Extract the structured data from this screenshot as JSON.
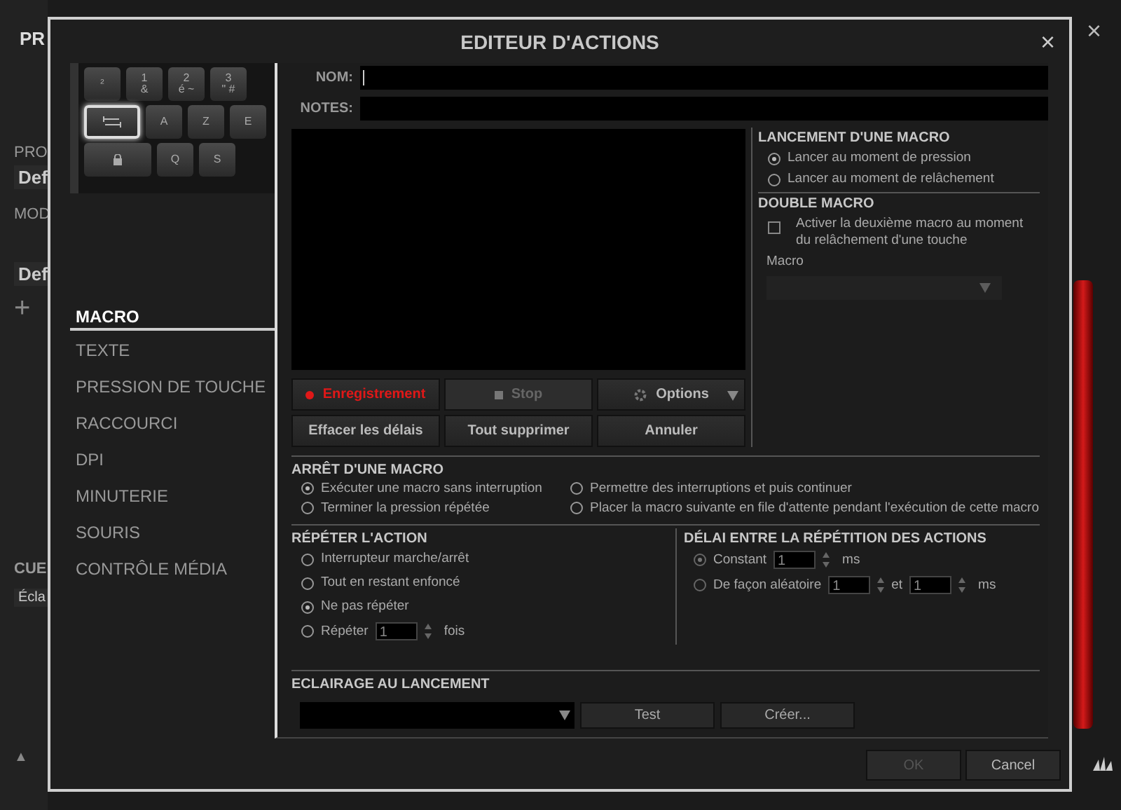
{
  "background_app": {
    "header_tab": "PR",
    "profile_label": "PRO",
    "profile_value": "Def",
    "mode_label": "MOD",
    "mode_tab": "Def",
    "add_button": "+",
    "cue_label": "CUE",
    "cue_value": "Écla",
    "scroll_up": "▲",
    "close": "×"
  },
  "window": {
    "title": "EDITEUR D'ACTIONS",
    "close": "×"
  },
  "keyboard": {
    "rows": [
      [
        {
          "label": "²",
          "kind": "wide",
          "selected": false
        },
        {
          "label": "1",
          "sub": "&",
          "kind": "key",
          "selected": false
        },
        {
          "label": "2",
          "sub": "é ~",
          "kind": "key",
          "selected": false
        },
        {
          "label": "3",
          "sub": "\" #",
          "kind": "key",
          "selected": false
        }
      ],
      [
        {
          "kind": "tab",
          "selected": true
        },
        {
          "label": "A",
          "kind": "key",
          "selected": false
        },
        {
          "label": "Z",
          "kind": "key",
          "selected": false
        },
        {
          "label": "E",
          "kind": "key",
          "selected": false
        }
      ],
      [
        {
          "kind": "lock",
          "selected": false
        },
        {
          "label": "Q",
          "kind": "key",
          "selected": false
        },
        {
          "label": "S",
          "kind": "key",
          "selected": false
        }
      ]
    ]
  },
  "action_types": [
    {
      "label": "MACRO",
      "selected": true
    },
    {
      "label": "TEXTE",
      "selected": false
    },
    {
      "label": "PRESSION DE TOUCHE",
      "selected": false
    },
    {
      "label": "RACCOURCI",
      "selected": false
    },
    {
      "label": "DPI",
      "selected": false
    },
    {
      "label": "MINUTERIE",
      "selected": false
    },
    {
      "label": "SOURIS",
      "selected": false
    },
    {
      "label": "CONTRÔLE MÉDIA",
      "selected": false
    }
  ],
  "name_field": {
    "label": "NOM:",
    "focused": true
  },
  "notes_field": {
    "label": "NOTES:",
    "focused": false
  },
  "macro_buttons": [
    {
      "label": "Enregistrement",
      "kind": "record",
      "disabled": false
    },
    {
      "label": "Stop",
      "kind": "stop",
      "disabled": true
    },
    {
      "label": "Options",
      "kind": "menu",
      "disabled": false
    },
    {
      "label": "Effacer les délais",
      "kind": "plain",
      "disabled": false
    },
    {
      "label": "Tout supprimer",
      "kind": "plain",
      "disabled": false
    },
    {
      "label": "Annuler",
      "kind": "plain",
      "disabled": false
    }
  ],
  "launch": {
    "title": "LANCEMENT D'UNE MACRO",
    "options": [
      {
        "label": "Lancer au moment de pression",
        "selected": true
      },
      {
        "label": "Lancer au moment de relâchement",
        "selected": false
      }
    ]
  },
  "double_macro": {
    "title": "DOUBLE MACRO",
    "checkbox": {
      "label": "Activer la deuxième macro au moment du relâchement d'une touche",
      "checked": false
    },
    "macro_label": "Macro",
    "dropdown": {
      "disabled": true
    }
  },
  "stop": {
    "title": "ARRÊT D'UNE MACRO",
    "options": [
      {
        "label": "Exécuter une macro sans interruption",
        "selected": true
      },
      {
        "label": "Permettre des interruptions et puis continuer",
        "selected": false
      },
      {
        "label": "Terminer la pression répétée",
        "selected": false
      },
      {
        "label": "Placer la macro suivante en file d'attente pendant l'exécution de cette macro",
        "selected": false
      }
    ]
  },
  "repeat": {
    "title": "RÉPÉTER L'ACTION",
    "options": [
      {
        "label": "Interrupteur marche/arrêt",
        "kind": "radio",
        "selected": false
      },
      {
        "label": "Tout en restant enfoncé",
        "kind": "radio",
        "selected": false
      },
      {
        "label": "Ne pas répéter",
        "kind": "radio",
        "selected": true
      },
      {
        "label": "Répéter",
        "kind": "count",
        "value": "1",
        "suffix": "fois",
        "selected": false
      }
    ]
  },
  "delay": {
    "title": "DÉLAI ENTRE LA RÉPÉTITION DES ACTIONS",
    "disabled": true,
    "options": [
      {
        "label": "Constant",
        "selected": true,
        "fields": [
          "1"
        ],
        "unit": "ms"
      },
      {
        "label": "De façon aléatoire",
        "selected": false,
        "fields": [
          "1",
          "1"
        ],
        "joiner": "et",
        "unit": "ms"
      }
    ]
  },
  "lighting": {
    "title": "ECLAIRAGE AU LANCEMENT",
    "buttons": [
      "Test",
      "Créer..."
    ]
  },
  "footer_buttons": [
    {
      "label": "OK",
      "disabled": true
    },
    {
      "label": "Cancel",
      "disabled": false
    }
  ]
}
